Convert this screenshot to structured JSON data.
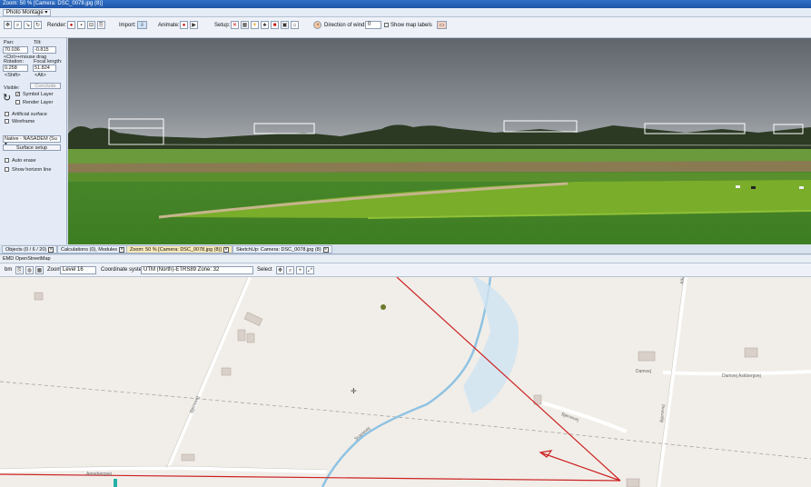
{
  "window": {
    "title": "Zoom: 50 % [Camera: DSC_0078.jpg (8)]"
  },
  "menu": {
    "photo_montage": "Photo Montage ▾"
  },
  "toolbar": {
    "render_label": "Render:",
    "import_label": "Import:",
    "animate_label": "Animate:",
    "setup_label": "Setup:",
    "wind_label": "Direction of wind:",
    "wind_value": "0",
    "show_map_labels": "Show map labels"
  },
  "camera": {
    "pan_label": "Pan:",
    "pan_value": "70.036",
    "tilt_label": "Tilt:",
    "tilt_value": "-0.815",
    "drag_hint": "<Ctrl>+mouse drag",
    "rotation_label": "Rotation:",
    "rotation_value": "0.258",
    "focal_label": "Focal length:",
    "focal_value": "51.824",
    "shift_hint": "<Shift>",
    "alt_hint": "<Alt>"
  },
  "layers": {
    "visible_label": "Visible:",
    "conclude_label": "Conclude",
    "symbol_layer": "Symbol Layer",
    "render_layer": "Render Layer",
    "artificial_surface": "Artificial surface",
    "wireframe": "Wireframe",
    "elevation_model": "Native - NASADEM (Su ▾",
    "surface_setup": "Surface setup",
    "auto_erase": "Auto erase",
    "show_horizon": "Show horizon line"
  },
  "tabs": [
    {
      "label": "Objects (0 / 6 / 20)",
      "active": false
    },
    {
      "label": "Calculations (0), Modules",
      "active": false
    },
    {
      "label": "Zoom: 50 % [Camera: DSC_0078.jpg (8)]",
      "active": true
    },
    {
      "label": "SketchUp: Camera: DSC_0078.jpg (8)",
      "active": false
    }
  ],
  "map_panel": {
    "title": "EMD OpenStreetMap",
    "bm_label": "bm",
    "zoom_label": "Zoom",
    "zoom_value": "Level 16",
    "coord_label": "Coordinate system",
    "coord_value": "UTM (North)-ETRS89 Zone: 32",
    "select_label": "Select"
  },
  "map_labels": {
    "road_a": "Annebergvej",
    "road_b": "Bjerrevej",
    "road_c": "Bjerrevej",
    "road_d": "Damvej",
    "road_e": "Svanevej",
    "road_f": "Alkærvej",
    "road_g": "Damvej Askbergvej",
    "road_h": "Bjerrevej",
    "road_i": "Bjerrestedvej"
  },
  "colors": {
    "accent": "#2f6fc6",
    "sight_line": "#cc2222",
    "river": "#8fc3e3",
    "map_bg": "#f1eee9"
  }
}
